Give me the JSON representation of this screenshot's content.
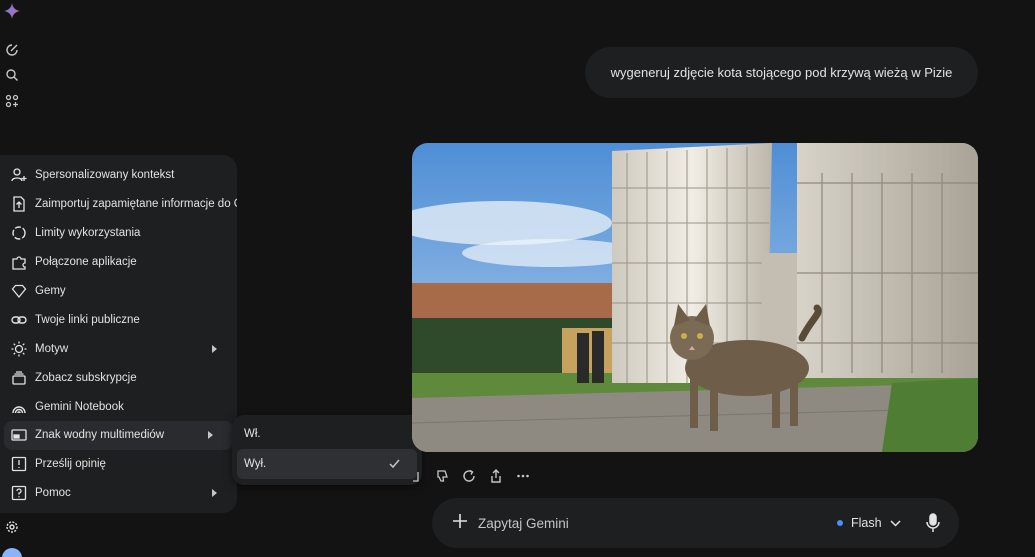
{
  "chat": {
    "user_prompt": "wygeneruj zdjęcie kota stojącego pod krzywą wieżą w Pizie"
  },
  "settings_menu": {
    "items": [
      {
        "label": "Spersonalizowany kontekst",
        "icon": "person-plus-icon"
      },
      {
        "label": "Zaimportuj zapamiętane informacje do Gemini",
        "icon": "import-icon"
      },
      {
        "label": "Limity wykorzystania",
        "icon": "usage-icon"
      },
      {
        "label": "Połączone aplikacje",
        "icon": "puzzle-icon"
      },
      {
        "label": "Gemy",
        "icon": "gem-icon"
      },
      {
        "label": "Twoje linki publiczne",
        "icon": "link-icon"
      },
      {
        "label": "Motyw",
        "icon": "theme-icon"
      },
      {
        "label": "Zobacz subskrypcje",
        "icon": "subscriptions-icon"
      },
      {
        "label": "Gemini Notebook",
        "icon": "notebook-icon"
      },
      {
        "label": "Znak wodny multimediów",
        "icon": "watermark-icon"
      },
      {
        "label": "Prześlij opinię",
        "icon": "feedback-icon"
      },
      {
        "label": "Pomoc",
        "icon": "help-icon"
      }
    ]
  },
  "watermark_submenu": {
    "on_label": "Wł.",
    "off_label": "Wył.",
    "selected": "off"
  },
  "input": {
    "placeholder": "Zapytaj Gemini",
    "model_label": "Flash"
  },
  "colors": {
    "background": "#131314",
    "surface": "#1e1f20",
    "accent_dot": "#4c8df6"
  }
}
